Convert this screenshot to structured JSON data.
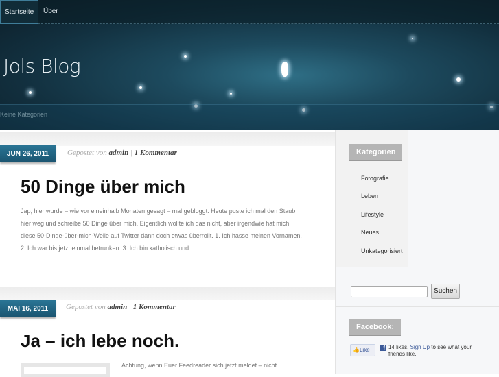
{
  "nav": {
    "items": [
      {
        "label": "Startseite",
        "active": true
      },
      {
        "label": "Über",
        "active": false
      }
    ]
  },
  "header": {
    "blog_title": "Jols Blog",
    "categories_text": "Keine Kategorien"
  },
  "posts": [
    {
      "date": "JUN 26, 2011",
      "meta_prefix": "Gepostet von",
      "author": "admin",
      "sep": "|",
      "comments": "1 Kommentar",
      "title": "50 Dinge über mich",
      "excerpt_lines": [
        "Jap, hier wurde – wie vor eineinhalb Monaten gesagt – mal gebloggt. Heute puste ich mal den Staub",
        "hier weg und schreibe 50 Dinge über mich. Eigentlich wollte ich das nicht, aber irgendwie hat mich",
        "diese 50-Dinge-über-mich-Welle auf Twitter dann doch etwas überrollt. 1. Ich hasse meinen Vornamen.",
        "2. Ich war bis jetzt einmal betrunken. 3. Ich bin katholisch und..."
      ]
    },
    {
      "date": "MAI 16, 2011",
      "meta_prefix": "Gepostet von",
      "author": "admin",
      "sep": "|",
      "comments": "1 Kommentar",
      "title": "Ja – ich lebe noch.",
      "excerpt": "Achtung, wenn Euer Feedreader sich jetzt meldet – nicht"
    }
  ],
  "sidebar": {
    "categories_title": "Kategorien",
    "categories": [
      "Fotografie",
      "Leben",
      "Lifestyle",
      "Neues",
      "Unkategorisiert"
    ],
    "search": {
      "value": "",
      "button": "Suchen"
    },
    "facebook_title": "Facebook:",
    "facebook": {
      "like": "Like",
      "icon": "f",
      "likes": "14 likes.",
      "signup": "Sign Up",
      "rest": "to see what your friends like."
    }
  }
}
